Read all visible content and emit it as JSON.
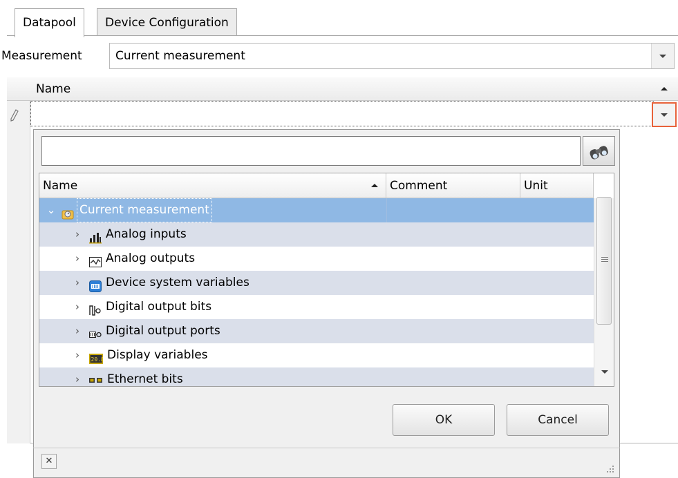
{
  "tabs": [
    {
      "label": "Datapool",
      "active": true
    },
    {
      "label": "Device Configuration",
      "active": false
    }
  ],
  "measurement": {
    "label": "Measurement",
    "value": "Current measurement"
  },
  "grid": {
    "column_name": "Name",
    "edit_value": ""
  },
  "dropdown": {
    "search_value": "",
    "columns": [
      "Name",
      "Comment",
      "Unit"
    ],
    "rows": [
      {
        "label": "Current measurement",
        "icon": "measurement-folder-icon",
        "selected": true,
        "expanded": true
      },
      {
        "label": "Analog inputs",
        "icon": "bar-chart-icon"
      },
      {
        "label": "Analog outputs",
        "icon": "waveform-icon"
      },
      {
        "label": "Device system variables",
        "icon": "system-variables-icon"
      },
      {
        "label": "Digital output bits",
        "icon": "pulse-output-icon"
      },
      {
        "label": "Digital output ports",
        "icon": "port-output-icon"
      },
      {
        "label": "Display variables",
        "icon": "display-digits-icon"
      },
      {
        "label": "Ethernet bits",
        "icon": "ethernet-icon"
      }
    ],
    "ok_label": "OK",
    "cancel_label": "Cancel"
  },
  "colors": {
    "selection": "#8fb8e4",
    "alt_row": "#dadfea",
    "focus_border": "#e8623a"
  }
}
